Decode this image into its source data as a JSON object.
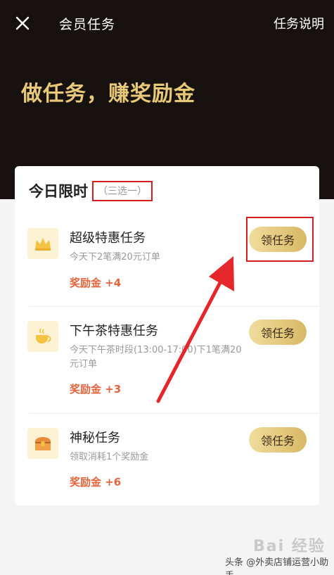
{
  "header": {
    "title": "会员任务",
    "help_label": "任务说明"
  },
  "hero": {
    "slogan": "做任务，赚奖励金"
  },
  "card": {
    "title": "今日限时",
    "subtitle": "（三选一）",
    "tasks": [
      {
        "name": "超级特惠任务",
        "desc": "今天下2笔满20元订单",
        "reward": "奖励金 +4",
        "button": "领任务",
        "icon": "crown-icon"
      },
      {
        "name": "下午茶特惠任务",
        "desc": "今天下午茶时段(13:00-17:00)下1笔满20元订单",
        "reward": "奖励金 +3",
        "button": "领任务",
        "icon": "teacup-icon"
      },
      {
        "name": "神秘任务",
        "desc": "领取消耗1个奖励金",
        "reward": "奖励金 +6",
        "button": "领任务",
        "icon": "treasure-chest-icon"
      }
    ]
  },
  "watermark": {
    "logo_text": "Bai 经验",
    "credit": "头条 @外卖店铺运营小助手"
  },
  "colors": {
    "hero_bg": "#17120f",
    "slogan": "#e8c97a",
    "reward": "#e2643c",
    "button_gradient_start": "#f1dc9c",
    "button_gradient_end": "#d8b866",
    "annotation": "#d41f1f"
  }
}
